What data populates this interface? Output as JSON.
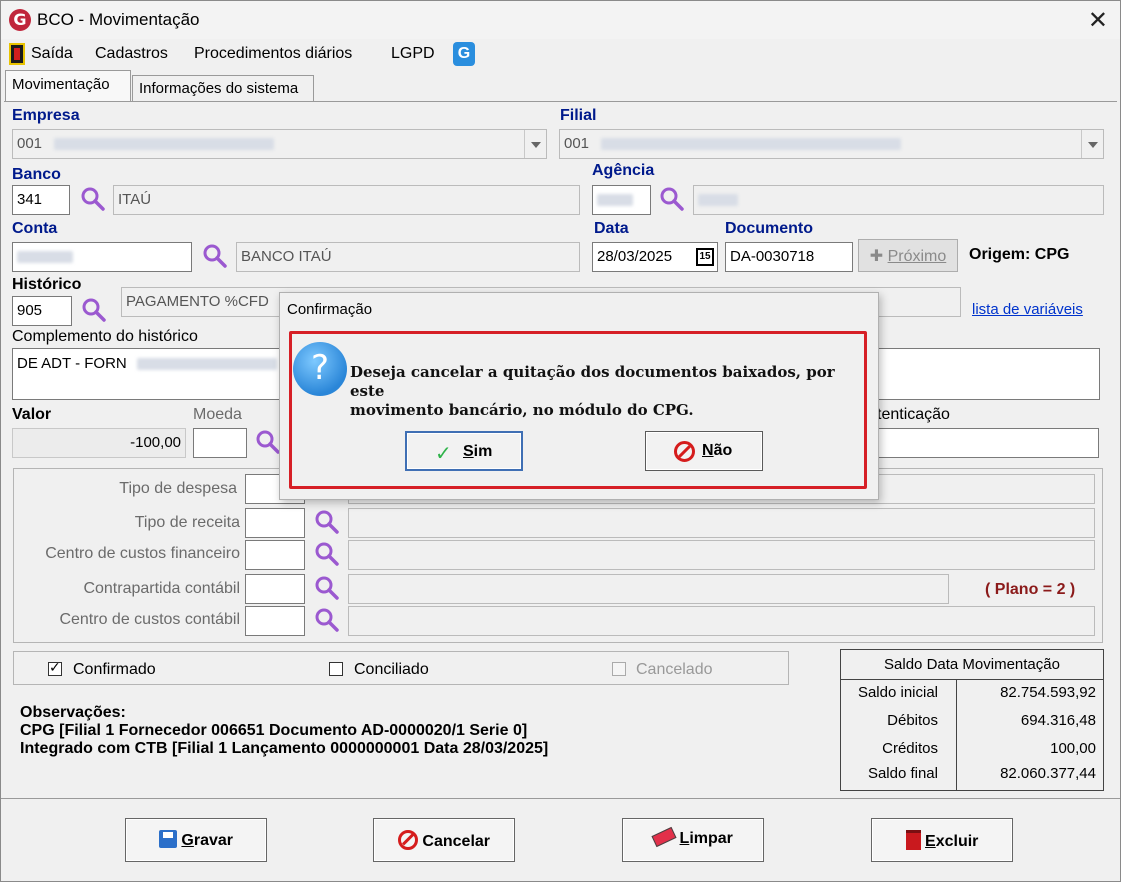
{
  "window": {
    "title": "BCO - Movimentação",
    "close_icon": "✕"
  },
  "menu": {
    "items": [
      "Saída",
      "Cadastros",
      "Procedimentos diários",
      "LGPD"
    ]
  },
  "tabs": [
    "Movimentação",
    "Informações do sistema"
  ],
  "form": {
    "empresa": {
      "label": "Empresa",
      "value": "001"
    },
    "filial": {
      "label": "Filial",
      "value": "001"
    },
    "banco": {
      "label": "Banco",
      "code": "341",
      "name": "ITAÚ"
    },
    "agencia": {
      "label": "Agência"
    },
    "conta": {
      "label": "Conta",
      "name": "BANCO ITAÚ"
    },
    "data": {
      "label": "Data",
      "value": "28/03/2025",
      "calendar_day": "15"
    },
    "documento": {
      "label": "Documento",
      "value": "DA-0030718"
    },
    "proximo_label": "Próximo",
    "origem": "Origem: CPG",
    "historico": {
      "label": "Histórico",
      "code": "905",
      "text": "PAGAMENTO %CFD"
    },
    "lista_variaveis": "lista de variáveis",
    "complemento": {
      "label": "Complemento do histórico",
      "text": "DE ADT - FORN"
    },
    "valor": {
      "label": "Valor",
      "value": "-100,00"
    },
    "moeda_label": "Moeda",
    "autenticacao_label": "tenticação",
    "tipo_despesa": "Tipo de despesa",
    "tipo_receita": "Tipo de receita",
    "centro_custos_fin": "Centro de custos financeiro",
    "contrapartida": "Contrapartida contábil",
    "centro_custos_cont": "Centro de custos contábil",
    "plano": "( Plano = 2 )"
  },
  "checks": {
    "confirmado": {
      "label": "Confirmado",
      "checked": true
    },
    "conciliado": {
      "label": "Conciliado",
      "checked": false
    },
    "cancelado": {
      "label": "Cancelado",
      "checked": false
    }
  },
  "observacoes": {
    "label": "Observações:",
    "line1": "CPG [Filial 1 Fornecedor 006651 Documento AD-0000020/1 Serie 0]",
    "line2": "Integrado com CTB [Filial 1 Lançamento 0000000001 Data 28/03/2025]"
  },
  "saldo": {
    "title": "Saldo Data Movimentação",
    "rows": [
      {
        "label": "Saldo inicial",
        "value": "82.754.593,92"
      },
      {
        "label": "Débitos",
        "value": "694.316,48"
      },
      {
        "label": "Créditos",
        "value": "100,00"
      },
      {
        "label": "Saldo final",
        "value": "82.060.377,44"
      }
    ]
  },
  "buttons": {
    "gravar": {
      "mnemonic": "G",
      "rest": "ravar"
    },
    "cancelar": "Cancelar",
    "limpar": {
      "mnemonic": "L",
      "rest": "impar"
    },
    "excluir": {
      "mnemonic": "E",
      "rest": "xcluir"
    }
  },
  "dialog": {
    "title": "Confirmação",
    "line1": "Deseja cancelar a quitação dos documentos baixados, por este",
    "line2": "movimento bancário, no módulo do CPG.",
    "sim": {
      "mnemonic": "S",
      "rest": "im"
    },
    "nao": {
      "mnemonic": "N",
      "rest": "ão"
    }
  },
  "colors": {
    "label_blue": "#001a8c",
    "dialog_highlight": "#d61f26",
    "plano_red": "#8b1a1a",
    "search_purple": "#9b59d0"
  }
}
